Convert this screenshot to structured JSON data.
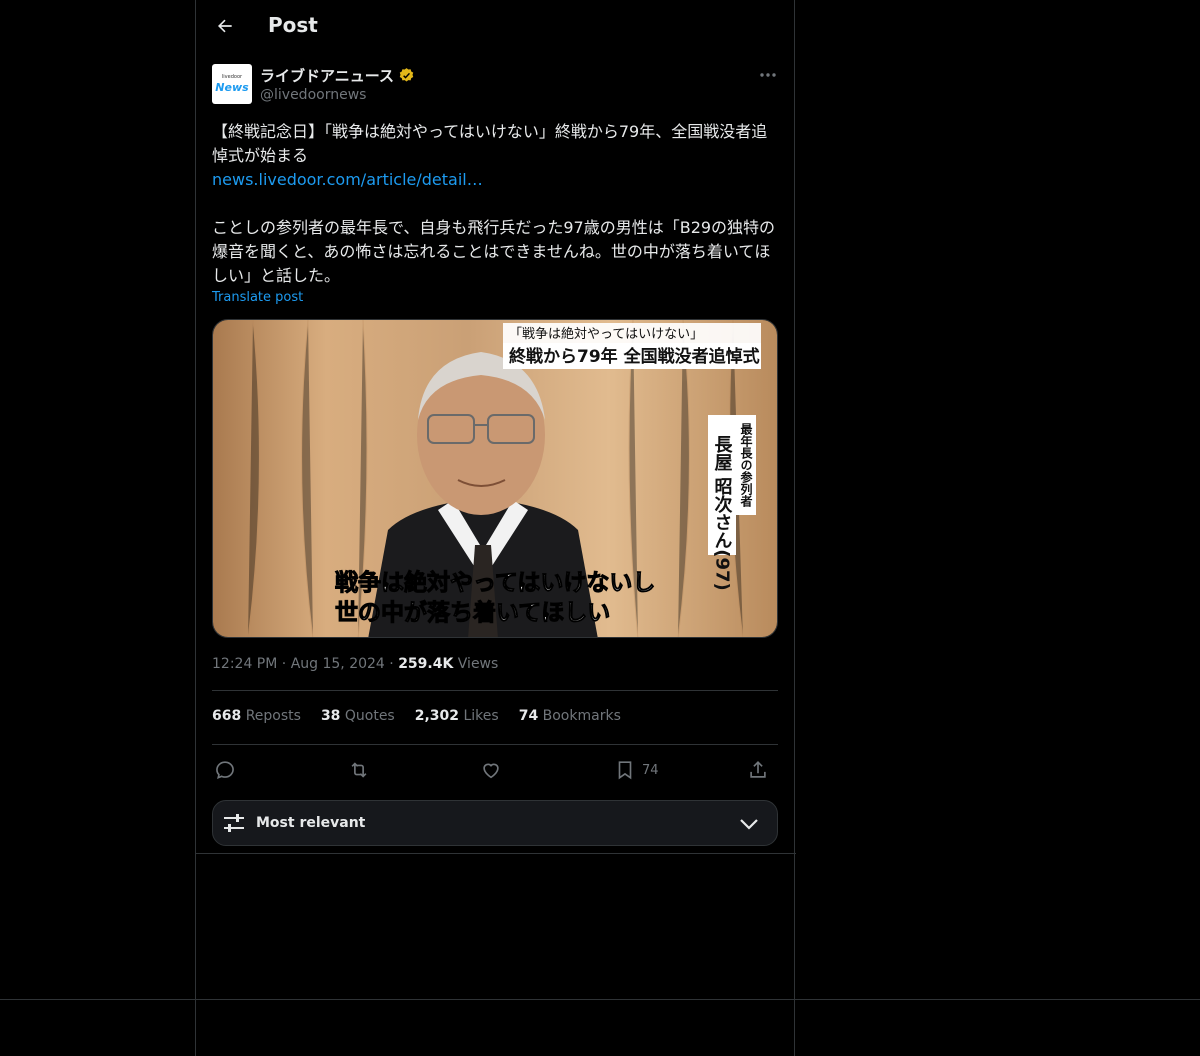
{
  "header": {
    "title": "Post"
  },
  "author": {
    "avatar_top": "livedoor",
    "avatar_main": "News",
    "name": "ライブドアニュース",
    "handle": "@livedoornews"
  },
  "tweet": {
    "line1": "【終戦記念日】「戦争は絶対やってはいけない」終戦から79年、全国戦没者追悼式が始まる",
    "link": "news.livedoor.com/article/detail…",
    "body": "ことしの参列者の最年長で、自身も飛行兵だった97歳の男性は「B29の独特の爆音を聞くと、あの怖さは忘れることはできませんね。世の中が落ち着いてほしい」と話した。",
    "translate": "Translate post"
  },
  "media": {
    "headline_small": "「戦争は絶対やってはいけない」",
    "headline_large": "終戦から79年 全国戦没者追悼式",
    "vertical_caption": "最年長の参列者",
    "vertical_name": "長屋 昭次さん(97)",
    "subtitle_line1": "戦争は絶対やってはいけないし",
    "subtitle_line2": "世の中が落ち着いてほしい"
  },
  "meta": {
    "time": "12:24 PM",
    "date": "Aug 15, 2024",
    "views_count": "259.4K",
    "views_label": "Views"
  },
  "stats": {
    "reposts_count": "668",
    "reposts_label": "Reposts",
    "quotes_count": "38",
    "quotes_label": "Quotes",
    "likes_count": "2,302",
    "likes_label": "Likes",
    "bookmarks_count": "74",
    "bookmarks_label": "Bookmarks"
  },
  "actions": {
    "bookmark_count": "74"
  },
  "sort": {
    "label": "Most relevant"
  },
  "colors": {
    "accent": "#1d9bf0",
    "verified": "#e2b719",
    "bg": "#000000",
    "border": "#2f3336",
    "muted": "#71767b"
  }
}
